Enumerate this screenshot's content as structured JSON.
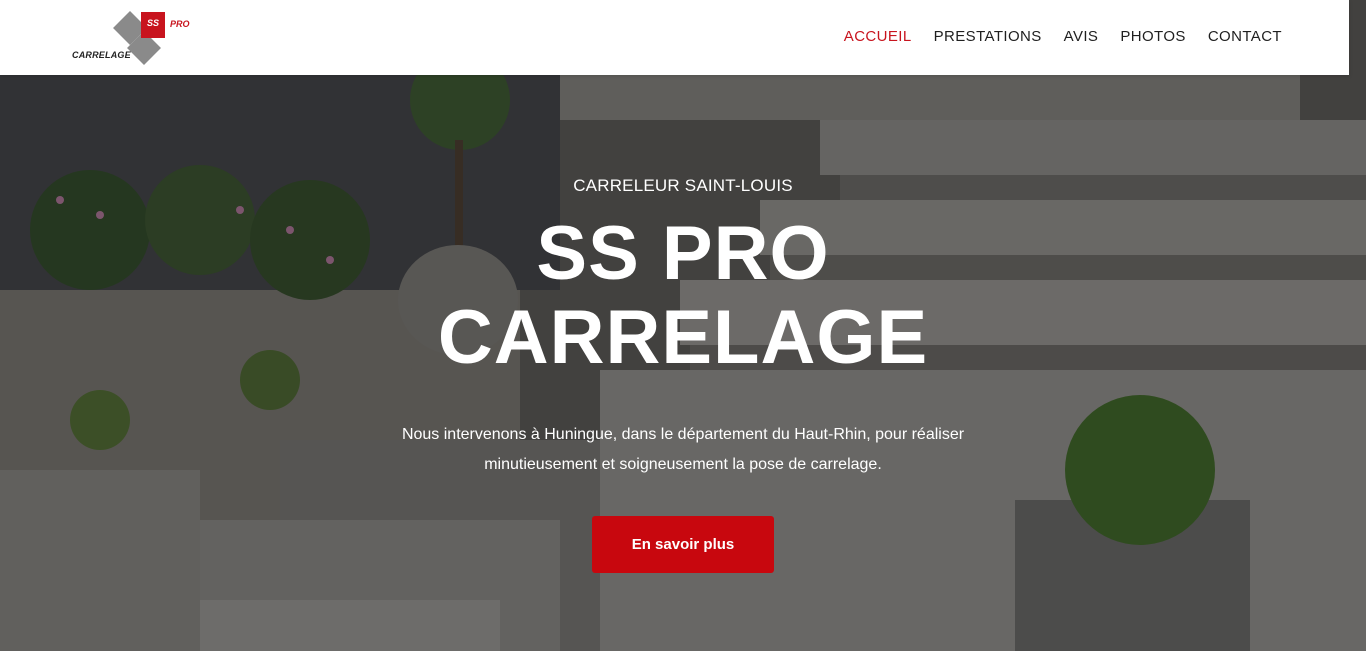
{
  "colors": {
    "accent": "#c8141e",
    "header_bg": "#ffffff",
    "nav_text": "#1f1f1f"
  },
  "logo": {
    "mark_text": "SS",
    "pro_text": "PRO",
    "word": "CARRELAGE"
  },
  "nav": {
    "items": [
      {
        "label": "ACCUEIL",
        "active": true
      },
      {
        "label": "PRESTATIONS",
        "active": false
      },
      {
        "label": "AVIS",
        "active": false
      },
      {
        "label": "PHOTOS",
        "active": false
      },
      {
        "label": "CONTACT",
        "active": false
      }
    ]
  },
  "hero": {
    "eyebrow": "CARRELEUR SAINT-LOUIS",
    "title_line1": "SS PRO",
    "title_line2": "CARRELAGE",
    "description": "Nous intervenons à Huningue, dans le département du Haut-Rhin, pour réaliser minutieusement et soigneusement la pose de carrelage.",
    "cta_label": "En savoir plus",
    "background_image": "stone-steps-garden-photo"
  }
}
